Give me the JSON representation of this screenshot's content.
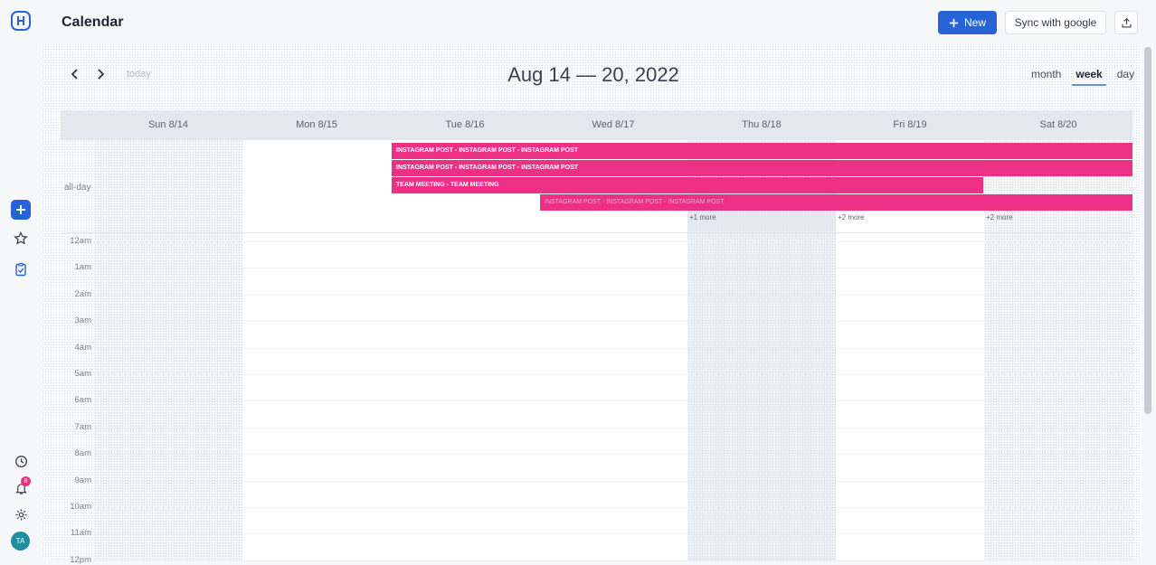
{
  "app": {
    "title": "Calendar"
  },
  "sidebar": {
    "items": [
      {
        "name": "add",
        "icon": "plus-icon"
      },
      {
        "name": "favorites",
        "icon": "star-icon"
      },
      {
        "name": "tasks",
        "icon": "clipboard-check-icon"
      }
    ],
    "bottom": [
      {
        "name": "history",
        "icon": "clock-icon"
      },
      {
        "name": "notifications",
        "icon": "bell-icon",
        "badge": "8"
      },
      {
        "name": "settings",
        "icon": "gear-icon"
      }
    ],
    "avatar_initials": "TA"
  },
  "toolbar": {
    "new_label": "New",
    "sync_label": "Sync with google",
    "share_icon": "upload-icon"
  },
  "calendar": {
    "today_label": "today",
    "range_title": "Aug 14 — 20, 2022",
    "views": [
      "month",
      "week",
      "day"
    ],
    "active_view": "week",
    "days": [
      "Sun 8/14",
      "Mon 8/15",
      "Tue 8/16",
      "Wed 8/17",
      "Thu 8/18",
      "Fri 8/19",
      "Sat 8/20"
    ],
    "all_day_label": "all-day",
    "events": [
      {
        "title": "INSTAGRAM POST - INSTAGRAM POST - INSTAGRAM POST"
      },
      {
        "title": "INSTAGRAM POST - INSTAGRAM POST - INSTAGRAM POST"
      },
      {
        "title": "TEAM MEETING - TEAM MEETING"
      },
      {
        "title": "INSTAGRAM POST - INSTAGRAM POST - INSTAGRAM POST"
      }
    ],
    "more_links": [
      "+1 more",
      "+2 more",
      "+2 more"
    ],
    "hours": [
      "12am",
      "1am",
      "2am",
      "3am",
      "4am",
      "5am",
      "6am",
      "7am",
      "8am",
      "9am",
      "10am",
      "11am",
      "12pm"
    ]
  },
  "colors": {
    "accent": "#2563d6",
    "event": "#ee2f86",
    "badge": "#e8337a"
  }
}
